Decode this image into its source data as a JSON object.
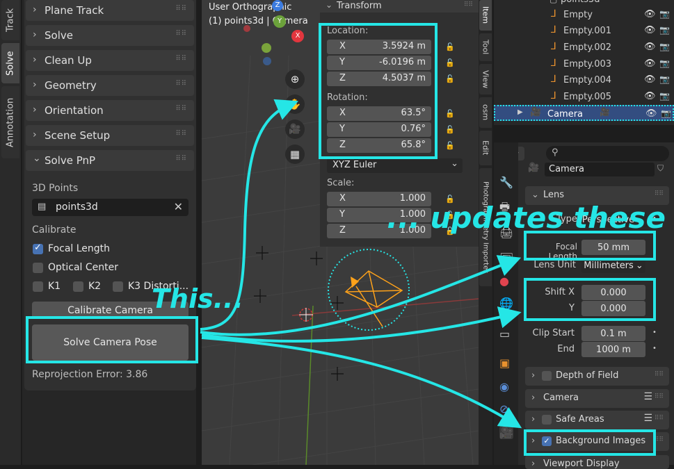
{
  "left_tabs": [
    "Track",
    "Solve",
    "Annotation"
  ],
  "sidebar": {
    "panels": [
      "Plane Track",
      "Solve",
      "Clean Up",
      "Geometry",
      "Orientation",
      "Scene Setup"
    ],
    "solve_pnp": {
      "title": "Solve PnP",
      "points_label": "3D Points",
      "points_value": "points3d",
      "calibrate_label": "Calibrate",
      "focal_length": "Focal Length",
      "optical_center": "Optical Center",
      "k1": "K1",
      "k2": "K2",
      "k3": "K3 Distorti...",
      "calibrate_button": "Calibrate Camera",
      "solve_button": "Solve Camera Pose",
      "error": "Reprojection Error: 3.86"
    }
  },
  "viewport": {
    "view_name": "User Orthographic",
    "object_info": "(1) points3d | Camera",
    "gizmo": {
      "x": "X",
      "y": "Y",
      "z": "Z"
    }
  },
  "transform": {
    "title": "Transform",
    "location_label": "Location:",
    "location": [
      {
        "axis": "X",
        "value": "3.5924 m"
      },
      {
        "axis": "Y",
        "value": "-6.0196 m"
      },
      {
        "axis": "Z",
        "value": "4.5037 m"
      }
    ],
    "rotation_label": "Rotation:",
    "rotation": [
      {
        "axis": "X",
        "value": "63.5°"
      },
      {
        "axis": "Y",
        "value": "0.76°"
      },
      {
        "axis": "Z",
        "value": "65.8°"
      }
    ],
    "rotation_mode": "XYZ Euler",
    "scale_label": "Scale:",
    "scale": [
      {
        "axis": "X",
        "value": "1.000"
      },
      {
        "axis": "Y",
        "value": "1.000"
      },
      {
        "axis": "Z",
        "value": "1.000"
      }
    ]
  },
  "n_tabs": [
    "Item",
    "Tool",
    "View",
    "osm",
    "Edit",
    "Photogrammetry Importer"
  ],
  "outliner": {
    "parent": "points3d",
    "rows": [
      "Empty",
      "Empty.001",
      "Empty.002",
      "Empty.003",
      "Empty.004",
      "Empty.005",
      "Camera"
    ]
  },
  "properties": {
    "search_placeholder": "",
    "object_name": "Camera",
    "lens_panel": "Lens",
    "type_label": "Type",
    "type_value": "Perspective",
    "focal_label": "Focal Length",
    "focal_value": "50 mm",
    "lens_unit_label": "Lens Unit",
    "lens_unit_value": "Millimeters",
    "shift_x_label": "Shift X",
    "shift_x_value": "0.000",
    "shift_y_label": "Y",
    "shift_y_value": "0.000",
    "clip_start_label": "Clip Start",
    "clip_start_value": "0.1 m",
    "clip_end_label": "End",
    "clip_end_value": "1000 m",
    "panels": [
      "Depth of Field",
      "Camera",
      "Safe Areas",
      "Background Images",
      "Viewport Display"
    ]
  },
  "annotations": {
    "this": "This...",
    "updates": "... updates these",
    "color": "#25e6e6"
  }
}
